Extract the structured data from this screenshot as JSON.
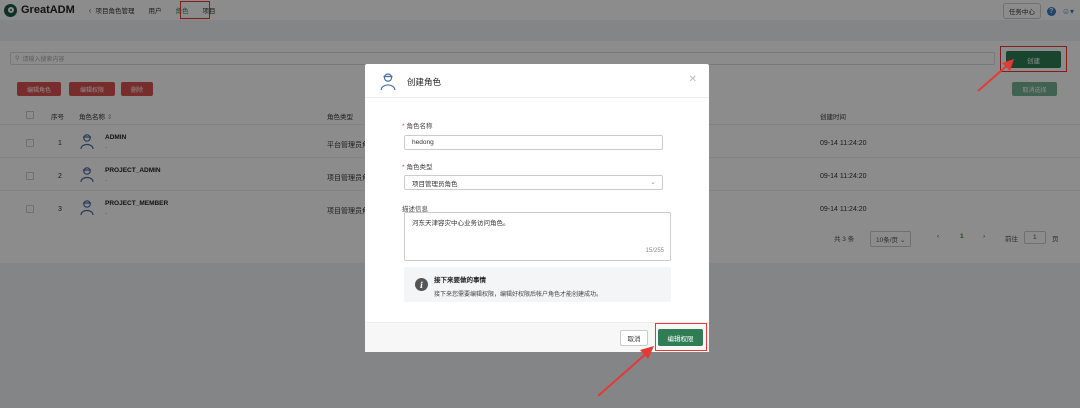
{
  "app": {
    "title": "GreatADM"
  },
  "nav": {
    "back_label": "项目角色管理",
    "items": [
      {
        "label": "用户"
      },
      {
        "label": "角色",
        "active": true
      },
      {
        "label": "项目"
      }
    ],
    "task_center": "任务中心"
  },
  "page": {
    "search_placeholder": "请输入搜索内容",
    "buttons": {
      "edit_role": "编辑角色",
      "edit_perm": "编辑权限",
      "delete": "删除",
      "create": "创建",
      "cancel_select": "取消选择"
    },
    "table": {
      "headers": {
        "index": "序号",
        "name": "角色名称",
        "type": "角色类型",
        "created": "创建时间"
      },
      "rows": [
        {
          "index": "1",
          "name": "ADMIN",
          "sub": "-",
          "type": "平台管理员角",
          "created": "09-14 11:24:20"
        },
        {
          "index": "2",
          "name": "PROJECT_ADMIN",
          "sub": "-",
          "type": "项目管理员角",
          "created": "09-14 11:24:20"
        },
        {
          "index": "3",
          "name": "PROJECT_MEMBER",
          "sub": "-",
          "type": "项目管理员角",
          "created": "09-14 11:24:20"
        }
      ]
    },
    "pager": {
      "total": "共 3 条",
      "page_size": "10条/页",
      "current": "1",
      "goto": "前往",
      "goto_value": "1",
      "page_unit": "页"
    }
  },
  "modal": {
    "title": "创建角色",
    "fields": {
      "name_label": "角色名称",
      "name_value": "hedong",
      "type_label": "角色类型",
      "type_value": "项目管理员角色",
      "desc_label": "描述信息",
      "desc_value": "河东天津容灾中心业务访问角色。",
      "desc_count": "15/255"
    },
    "info": {
      "title": "接下来要做的事情",
      "text": "接下来您需要编辑权限，编辑好权限后帐户角色才能创建成功。"
    },
    "buttons": {
      "cancel": "取消",
      "edit_perm": "编辑权限"
    }
  },
  "colors": {
    "accent": "#2e7d55",
    "danger": "#d9534f",
    "highlight": "#e53935"
  }
}
